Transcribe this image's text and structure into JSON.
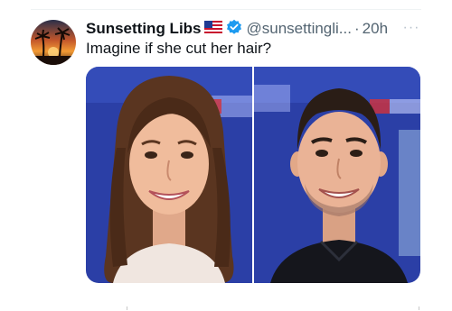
{
  "tweet": {
    "display_name": "Sunsetting Libs",
    "handle": "@sunsettingli...",
    "separator": "·",
    "time": "20h",
    "text": "Imagine if she cut her hair?",
    "more_label": "···"
  },
  "icons": {
    "flag": "us-flag-icon",
    "verified": "verified-badge-icon",
    "more": "more-options-icon"
  },
  "colors": {
    "verified": "#1d9bf0",
    "secondary_text": "#536471",
    "primary_text": "#0f1419",
    "backdrop": "#2b3fa6"
  }
}
